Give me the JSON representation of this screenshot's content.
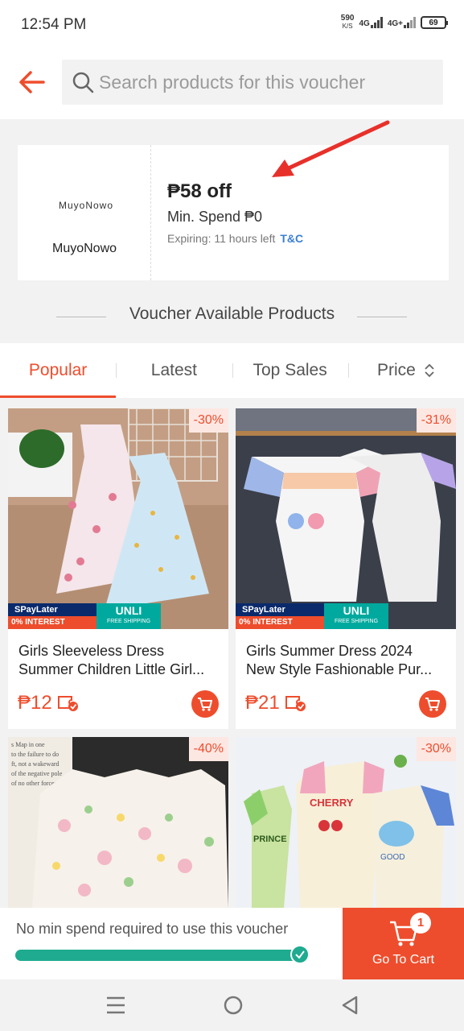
{
  "status_bar": {
    "time": "12:54 PM",
    "net_speed_value": "590",
    "net_speed_unit": "K/S",
    "network_1": "4G",
    "network_2": "4G+",
    "battery": "69"
  },
  "search": {
    "placeholder": "Search products for this voucher"
  },
  "voucher": {
    "shop_logo_text": "MuyoNowo",
    "shop_name": "MuyoNowo",
    "amount": "₱58 off",
    "min_spend": "Min. Spend ₱0",
    "expiry": "Expiring: 11 hours left",
    "tc_label": "T&C"
  },
  "section_title": "Voucher Available Products",
  "tabs": [
    {
      "label": "Popular"
    },
    {
      "label": "Latest"
    },
    {
      "label": "Top Sales"
    },
    {
      "label": "Price"
    }
  ],
  "promo": {
    "spaylater": "SPayLater",
    "interest": "0% INTEREST",
    "unli": "UNLI",
    "free_shipping": "FREE SHIPPING"
  },
  "products": [
    {
      "discount": "-30%",
      "title_line1": "Girls Sleeveless Dress",
      "title_line2": "Summer Children Little Girl...",
      "price": "₱12"
    },
    {
      "discount": "-31%",
      "title_line1": "Girls Summer Dress 2024",
      "title_line2": "New Style Fashionable Pur...",
      "price": "₱21"
    },
    {
      "discount": "-40%",
      "image_text": "s Map in one / to the failure to do / ft, not a wakeward / of the negative pole / of no other forces / the stars in one",
      "price": ""
    },
    {
      "discount": "-30%",
      "image_text_1": "CHERRY",
      "image_text_2": "PRINCE",
      "image_text_3": "GOOD",
      "price": ""
    }
  ],
  "bottom_bar": {
    "message": "No min spend required to use this voucher",
    "progress": 1.0,
    "cart_label": "Go To Cart",
    "cart_count": "1"
  },
  "colors": {
    "brand": "#ee4d2d",
    "progress": "#1fab8f",
    "link": "#3a7fd5"
  }
}
